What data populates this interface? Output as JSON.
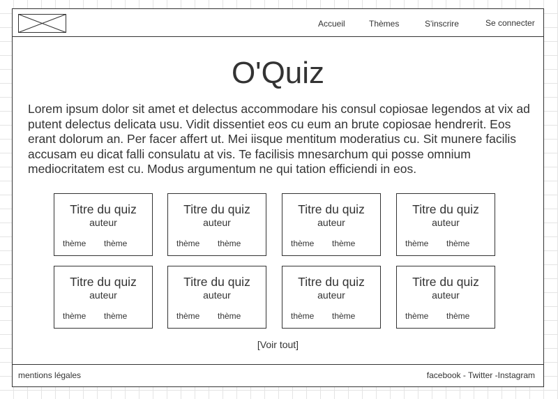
{
  "header": {
    "logo_icon": "image-placeholder-icon",
    "nav": [
      {
        "label": "Accueil"
      },
      {
        "label": "Thèmes"
      },
      {
        "label": "S'inscrire"
      },
      {
        "label": "Se connecter"
      }
    ]
  },
  "main": {
    "title": "O'Quiz",
    "intro": "Lorem ipsum dolor sit amet et delectus accommodare his consul copiosae legendos at vix ad putent delectus delicata usu. Vidit dissentiet eos cu eum an brute copiosae hendrerit. Eos erant dolorum an. Per facer affert ut. Mei iisque mentitum moderatius cu. Sit munere facilis accusam eu dicat falli consulatu at vis. Te facilisis mnesarchum qui posse omnium mediocritatem est cu. Modus argumentum ne qui tation efficiendi in eos.",
    "quizzes": [
      {
        "title": "Titre du quiz",
        "author": "auteur",
        "themes": [
          "thème",
          "thème"
        ]
      },
      {
        "title": "Titre du quiz",
        "author": "auteur",
        "themes": [
          "thème",
          "thème"
        ]
      },
      {
        "title": "Titre du quiz",
        "author": "auteur",
        "themes": [
          "thème",
          "thème"
        ]
      },
      {
        "title": "Titre du quiz",
        "author": "auteur",
        "themes": [
          "thème",
          "thème"
        ]
      },
      {
        "title": "Titre du quiz",
        "author": "auteur",
        "themes": [
          "thème",
          "thème"
        ]
      },
      {
        "title": "Titre du quiz",
        "author": "auteur",
        "themes": [
          "thème",
          "thème"
        ]
      },
      {
        "title": "Titre du quiz",
        "author": "auteur",
        "themes": [
          "thème",
          "thème"
        ]
      },
      {
        "title": "Titre du quiz",
        "author": "auteur",
        "themes": [
          "thème",
          "thème"
        ]
      }
    ],
    "see_all": "[Voir tout]"
  },
  "footer": {
    "legal": "mentions légales",
    "social": {
      "facebook": "facebook",
      "sep1": " - ",
      "twitter": "Twitter",
      "sep2": " -",
      "instagram": "Instagram"
    }
  }
}
